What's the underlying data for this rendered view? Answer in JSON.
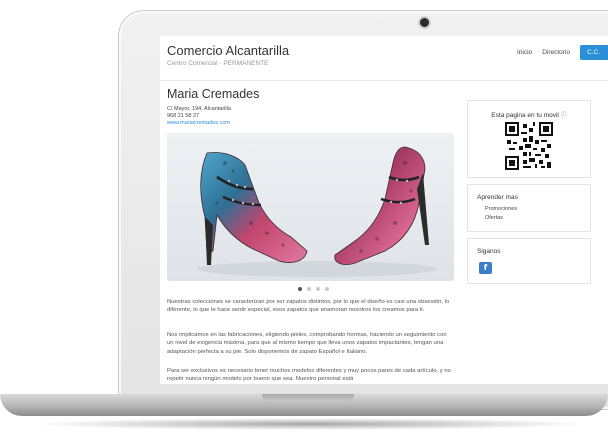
{
  "header": {
    "site_title": "Comercio Alcantarilla",
    "site_subtitle": "Centro Comercial - PERMANENTE",
    "nav": [
      {
        "label": "Inicio"
      },
      {
        "label": "Directorio"
      },
      {
        "label": "C.C."
      }
    ]
  },
  "business": {
    "name": "Maria Cremades",
    "address": "C/ Mayor, 194, Alcantarilla",
    "phone": "968 21 58 27",
    "website": "www.mariacremades.com"
  },
  "slider": {
    "image_icon": "shoes-photo",
    "dots_total": 4,
    "active_dot": 1
  },
  "content": {
    "paragraphs": [
      "Nuestras colecciones se caracterizan por ser zapatos distintos, por lo que el diseño es casi una obsesión, lo diferente, lo que te hace sentir especial, esos zapatos que enamoran nosotros los creamos para ti.",
      "Nos implicamos en las fabricaciones, eligiendo pieles, comprobando hormas, haciendo un seguimiento con un nivel de exigencia máxima, para que al mismo tiempo que lleva unos zapatos impactantes, tengan una adaptación perfecta a su pie. Solo disponemos de zapato Español e Italiano.",
      "Para ser exclusivos es necesario tener muchos modelos diferentes y muy pocos pares de cada artículo, y no repetir nunca ningún modelo por bueno que sea. Nuestro personal está"
    ]
  },
  "sidebar": {
    "qr": {
      "title": "Esta pagina en tu movil",
      "info_icon": "info-icon",
      "code_icon": "qr-code-icon"
    },
    "learn": {
      "title": "Aprender mas",
      "links": [
        "Promociones",
        "Ofertas"
      ]
    },
    "follow": {
      "title": "Siganos",
      "facebook_label": "f",
      "facebook_icon": "facebook-icon"
    }
  },
  "colors": {
    "accent": "#2a8fd6",
    "facebook": "#3b7ec8",
    "text": "#333333"
  }
}
